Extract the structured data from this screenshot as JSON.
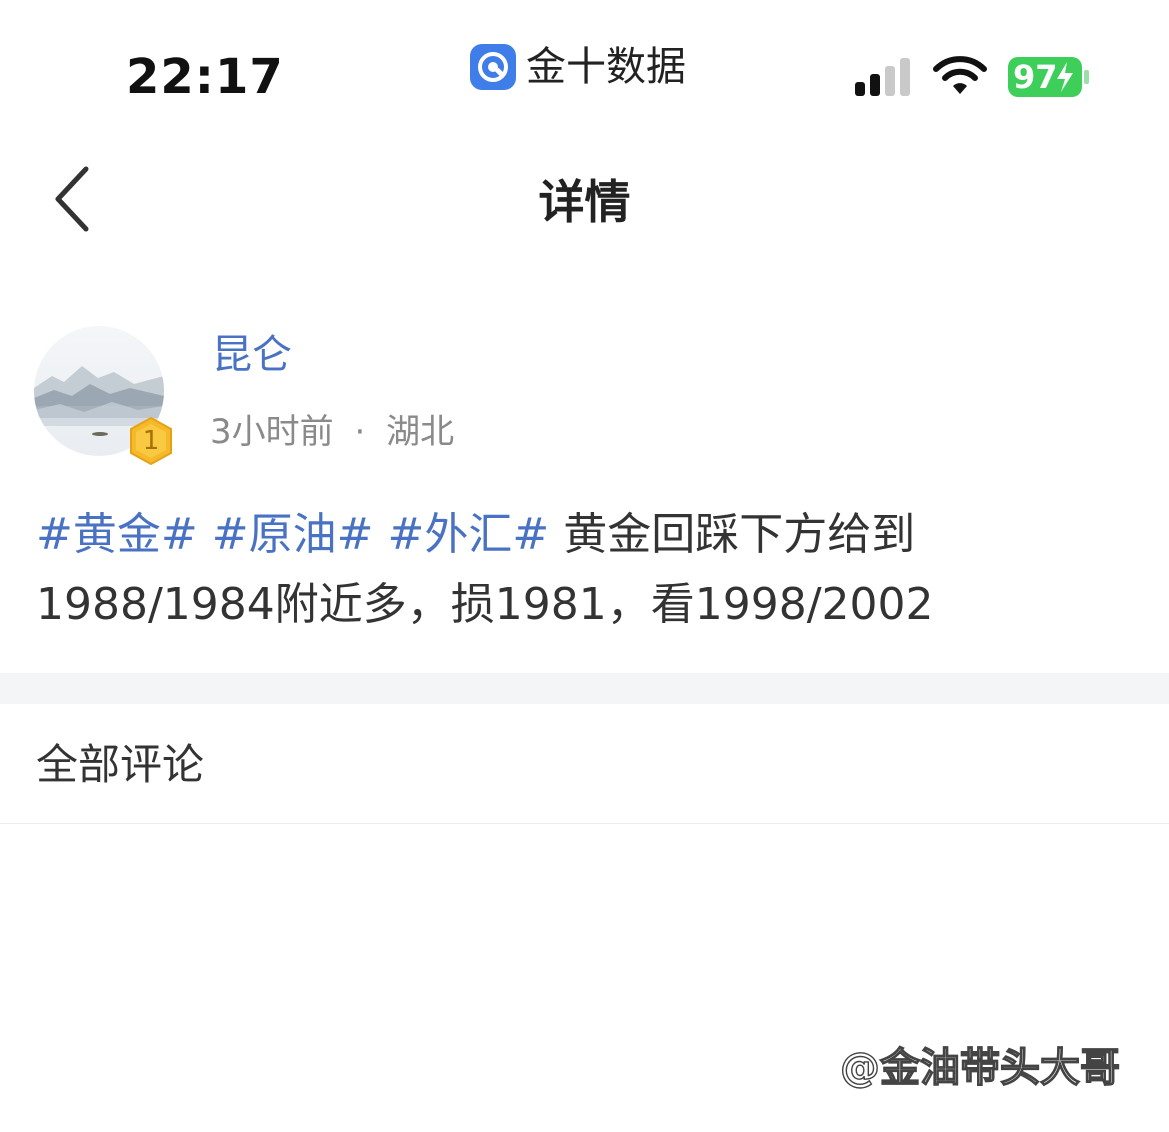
{
  "status_bar": {
    "time": "22:17",
    "carrier": "金十数据",
    "battery": "97"
  },
  "nav": {
    "title": "详情"
  },
  "post": {
    "author": "昆仑",
    "level": "1",
    "time_ago": "3小时前",
    "separator": "·",
    "location": "湖北",
    "tags": [
      "#黄金#",
      "#原油#",
      "#外汇#"
    ],
    "text": "黄金回踩下方给到1988/1984附近多，损1981，看1998/2002"
  },
  "comments": {
    "title": "全部评论"
  },
  "watermark": "@金油带头大哥",
  "colors": {
    "tag_blue": "#4a72c4",
    "battery_green": "#3ecf5b",
    "carrier_blue": "#3f7de8"
  }
}
